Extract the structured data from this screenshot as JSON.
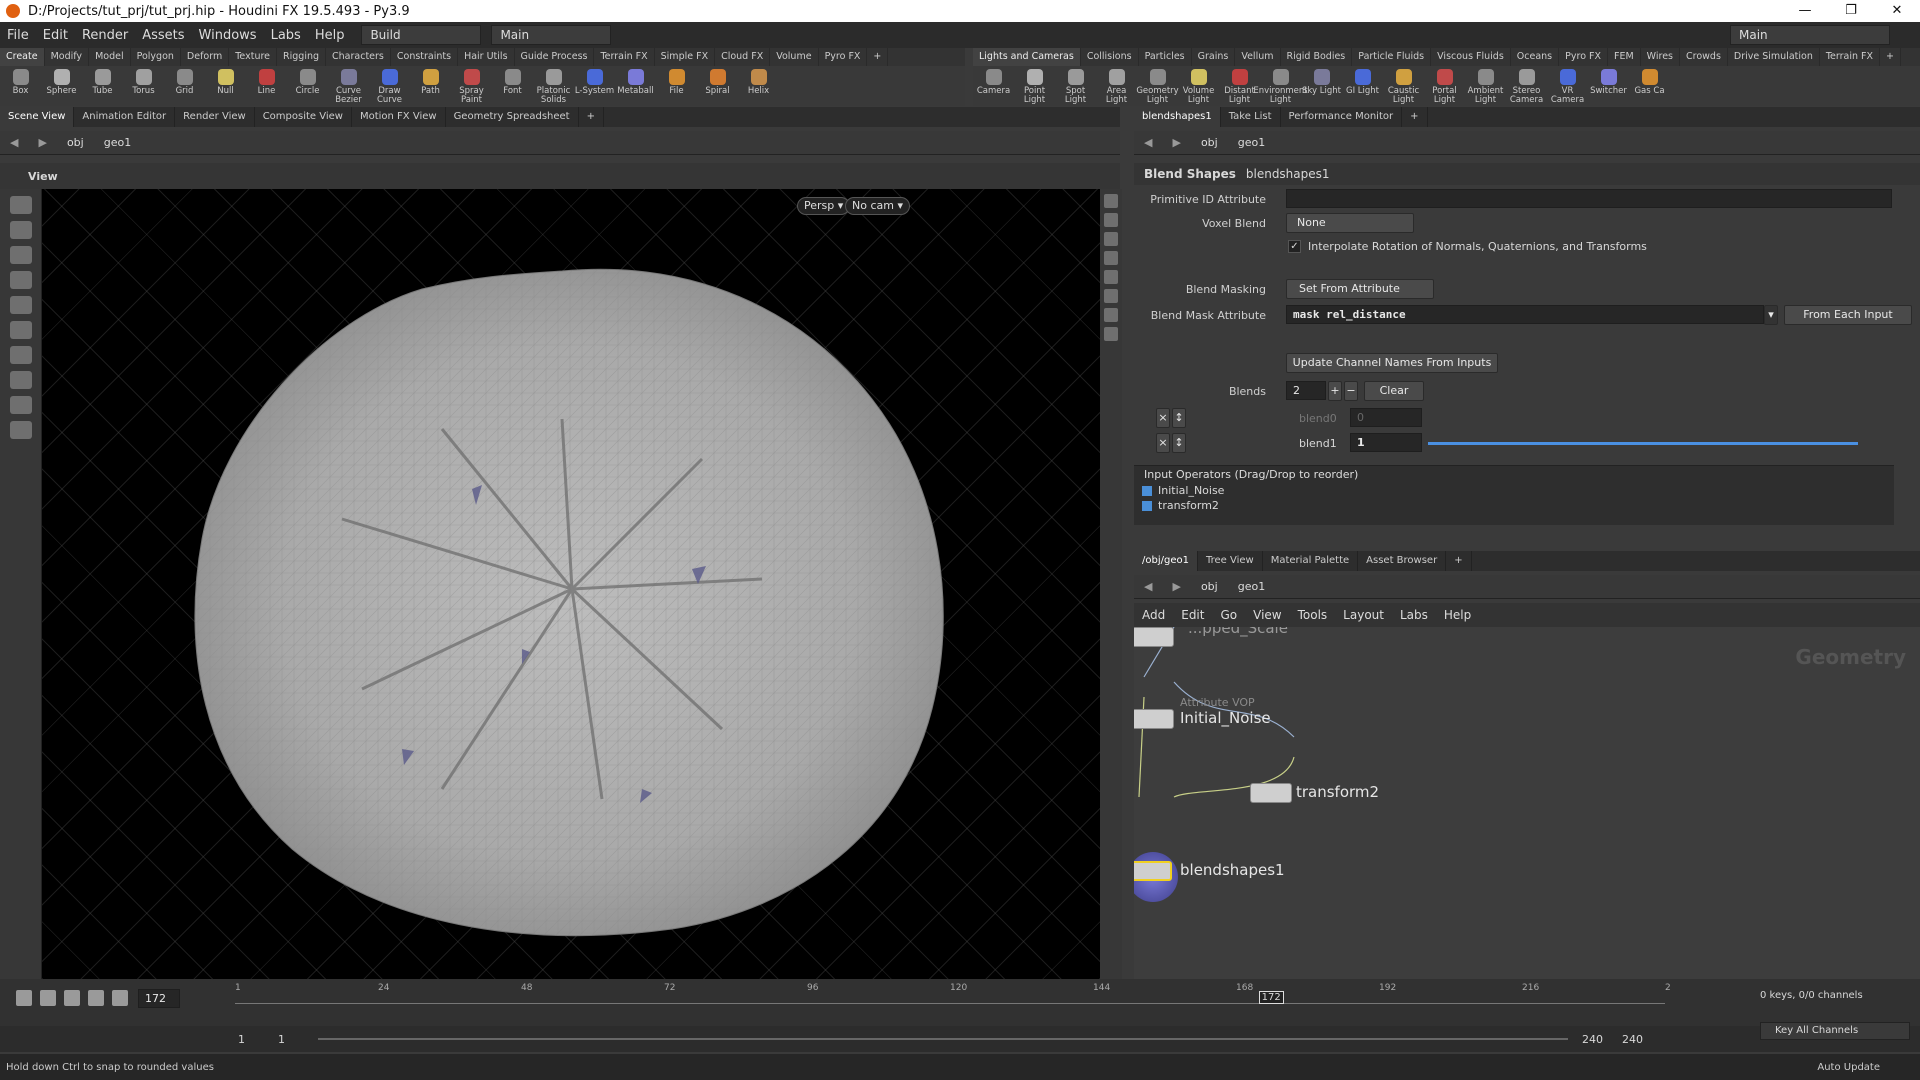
{
  "window": {
    "title": "D:/Projects/tut_prj/tut_prj.hip - Houdini FX 19.5.493 - Py3.9",
    "buttons": [
      "—",
      "❐",
      "✕"
    ]
  },
  "menubar": {
    "items": [
      "File",
      "Edit",
      "Render",
      "Assets",
      "Windows",
      "Labs",
      "Help"
    ],
    "build": "Build",
    "desktop": "Main",
    "right_desktop": "Main"
  },
  "shelf_left": {
    "tabs": [
      "Create",
      "Modify",
      "Model",
      "Polygon",
      "Deform",
      "Texture",
      "Rigging",
      "Characters",
      "Constraints",
      "Hair Utils",
      "Guide Process",
      "Terrain FX",
      "Simple FX",
      "Cloud FX",
      "Volume",
      "Pyro FX",
      "+"
    ],
    "tools": [
      "Box",
      "Sphere",
      "Tube",
      "Torus",
      "Grid",
      "Null",
      "Line",
      "Circle",
      "Curve Bezier",
      "Draw Curve",
      "Path",
      "Spray Paint",
      "Font",
      "Platonic Solids",
      "L-System",
      "Metaball",
      "File",
      "Spiral",
      "Helix"
    ]
  },
  "shelf_right": {
    "tabs": [
      "Lights and Cameras",
      "Collisions",
      "Particles",
      "Grains",
      "Vellum",
      "Rigid Bodies",
      "Particle Fluids",
      "Viscous Fluids",
      "Oceans",
      "Pyro FX",
      "FEM",
      "Wires",
      "Crowds",
      "Drive Simulation",
      "Terrain FX",
      "+"
    ],
    "tools": [
      "Camera",
      "Point Light",
      "Spot Light",
      "Area Light",
      "Geometry Light",
      "Volume Light",
      "Distant Light",
      "Environment Light",
      "Sky Light",
      "GI Light",
      "Caustic Light",
      "Portal Light",
      "Ambient Light",
      "Stereo Camera",
      "VR Camera",
      "Switcher",
      "Gas Ca"
    ]
  },
  "left_pane": {
    "tabs": [
      "Scene View",
      "Animation Editor",
      "Render View",
      "Composite View",
      "Motion FX View",
      "Geometry Spreadsheet",
      "+"
    ],
    "path": [
      "obj",
      "geo1"
    ],
    "view_label": "View",
    "persp": "Persp ▾",
    "cam": "No cam ▾"
  },
  "right_pane": {
    "tabs": [
      "blendshapes1",
      "Take List",
      "Performance Monitor",
      "+"
    ],
    "path": [
      "obj",
      "geo1"
    ]
  },
  "params": {
    "node_type": "Blend Shapes",
    "node_name": "blendshapes1",
    "primitive_id_label": "Primitive ID Attribute",
    "primitive_id_value": "",
    "voxel_blend_label": "Voxel Blend",
    "voxel_blend_value": "None",
    "interp_label": "Interpolate Rotation of Normals, Quaternions, and Transforms",
    "blend_masking_label": "Blend Masking",
    "blend_masking_value": "Set From Attribute",
    "mask_attr_label": "Blend Mask Attribute",
    "mask_attr_value": "mask rel_distance",
    "from_each": "From Each Input",
    "update_btn": "Update Channel Names From Inputs",
    "blends_label": "Blends",
    "blends_value": "2",
    "clear": "Clear",
    "blend0_label": "blend0",
    "blend0_value": "0",
    "blend1_label": "blend1",
    "blend1_value": "1",
    "blend1_level": 1.0,
    "inputs_header": "Input Operators (Drag/Drop to reorder)",
    "inputs": [
      "Initial_Noise",
      "transform2"
    ]
  },
  "net_pane": {
    "tabs": [
      "/obj/geo1",
      "Tree View",
      "Material Palette",
      "Asset Browser",
      "+"
    ],
    "path": [
      "obj",
      "geo1"
    ],
    "menu": [
      "Add",
      "Edit",
      "Go",
      "View",
      "Tools",
      "Layout",
      "Labs",
      "Help"
    ],
    "watermark": "Geometry",
    "nodes": {
      "top": "...pped_Scale",
      "noise_sub": "Attribute VOP",
      "noise": "Initial_Noise",
      "transform": "transform2",
      "blend": "blendshapes1"
    }
  },
  "timeline": {
    "current_frame": "172",
    "ticks": [
      "1",
      "24",
      "48",
      "72",
      "96",
      "120",
      "144",
      "168",
      "192",
      "216",
      "2"
    ],
    "marker": "172",
    "range_start": "1",
    "range_start2": "1",
    "range_end": "240",
    "range_end2": "240",
    "keys": "0 keys, 0/0 channels",
    "key_all": "Key All Channels",
    "auto_update": "Auto Update"
  },
  "status": {
    "message": "Hold down Ctrl to snap to rounded values"
  }
}
